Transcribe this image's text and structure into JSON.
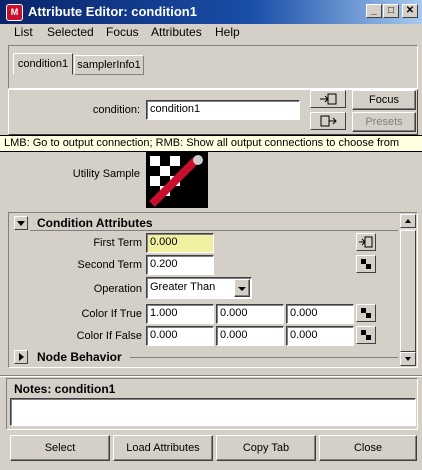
{
  "window": {
    "title": "Attribute Editor: condition1",
    "app_icon": "maya-icon",
    "controls": [
      "minimize-icon",
      "maximize-icon",
      "close-icon"
    ]
  },
  "menu": {
    "list": "List",
    "selected": "Selected",
    "focus": "Focus",
    "attributes": "Attributes",
    "help": "Help"
  },
  "tabs": [
    {
      "label": "condition1",
      "active": true
    },
    {
      "label": "samplerInfo1",
      "active": false
    }
  ],
  "node": {
    "name_label": "condition:",
    "name_value": "condition1",
    "focus_button": "Focus",
    "presets_button": "Presets"
  },
  "tooltip": "LMB: Go to output connection; RMB: Show all output connections to choose from",
  "swatch": {
    "label": "Utility Sample"
  },
  "condition_attributes": {
    "header": "Condition Attributes",
    "first_term_label": "First Term",
    "first_term_value": "0.000",
    "second_term_label": "Second Term",
    "second_term_value": "0.200",
    "operation_label": "Operation",
    "operation_value": "Greater Than",
    "color_if_true_label": "Color If True",
    "color_if_true": [
      "1.000",
      "0.000",
      "0.000"
    ],
    "color_if_false_label": "Color If False",
    "color_if_false": [
      "0.000",
      "0.000",
      "0.000"
    ]
  },
  "node_behavior": {
    "header": "Node Behavior"
  },
  "notes": {
    "label": "Notes: condition1",
    "value": ""
  },
  "bottom_buttons": {
    "select": "Select",
    "load_attributes": "Load Attributes",
    "copy_tab": "Copy Tab",
    "close": "Close"
  },
  "colors": {
    "titlebar": "#0a246a",
    "tooltip_bg": "#ffffe1",
    "highlight_field": "#f0f0a0",
    "swatch_red": "#c8102e"
  }
}
